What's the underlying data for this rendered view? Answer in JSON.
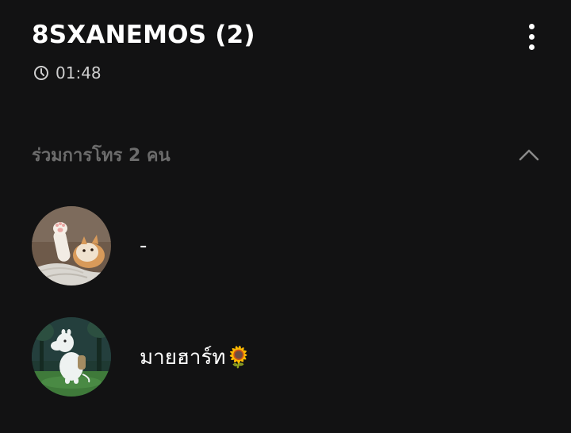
{
  "header": {
    "title": "8SXANEMOS (2)",
    "time": "01:48",
    "menu_icon": "more-vertical-icon",
    "clock_icon": "clock-icon"
  },
  "participants": {
    "title": "ร่วมการโทร 2 คน",
    "collapse_icon": "chevron-up-icon",
    "members": [
      {
        "name": "-",
        "avatar": "cat-avatar"
      },
      {
        "name": "มายฮาร์ท🌻",
        "avatar": "moomin-avatar"
      }
    ]
  },
  "colors": {
    "background": "#121213",
    "title_text": "#ffffff",
    "secondary_text": "#cfcfcf",
    "section_title": "#6c6c6c"
  }
}
